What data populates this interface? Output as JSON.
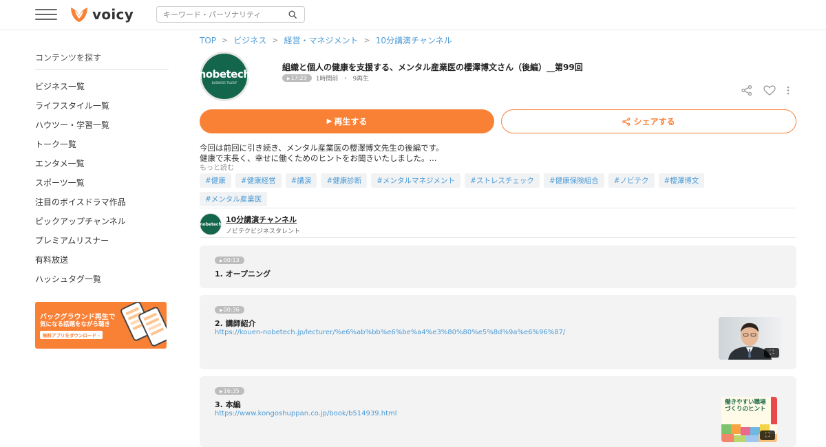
{
  "header": {
    "logo_text": "voicy",
    "search_placeholder": "キーワード・パーソナリティ"
  },
  "sidebar": {
    "title": "コンテンツを探す",
    "items": [
      "ビジネス一覧",
      "ライフスタイル一覧",
      "ハウツー・学習一覧",
      "トーク一覧",
      "エンタメ一覧",
      "スポーツ一覧",
      "注目のボイスドラマ作品",
      "ピックアップチャンネル",
      "プレミアムリスナー",
      "有料放送",
      "ハッシュタグ一覧"
    ],
    "banner": {
      "line1": "バックグラウンド再生で",
      "line2": "気になる話題をながら聴き",
      "cta": "無料アプリをダウンロード ›"
    }
  },
  "breadcrumb": [
    "TOP",
    "ビジネス",
    "経営・マネジメント",
    "10分講演チャンネル"
  ],
  "episode": {
    "logo_text": "nobetech",
    "logo_sub": "BUSINESS TALENT",
    "title": "組織と個人の健康を支援する、メンタル産業医の櫻澤博文さん（後編）__第99回",
    "duration": "17:23",
    "posted": "1時間前",
    "separator": "・",
    "plays": "9再生",
    "play_label": "再生する",
    "share_label": "シェアする",
    "description_line1": "今回は前回に引き続き、メンタル産業医の櫻澤博文先生の後編です。",
    "description_line2": "健康で末長く、幸せに働くためのヒントをお聞きいたしました。...",
    "more_label": "もっと読む",
    "tags": [
      "#健康",
      "#健康経営",
      "#講演",
      "#健康診断",
      "#メンタルマネジメント",
      "#ストレスチェック",
      "#健康保険組合",
      "#ノビテク",
      "#櫻澤博文",
      "#メンタル産業医"
    ]
  },
  "channel": {
    "icon_text": "nobetech",
    "name": "10分講演チャンネル",
    "subtitle": "ノビテクビジネスタレント"
  },
  "chapters": [
    {
      "time": "00:13",
      "title": "1. オープニング",
      "link": ""
    },
    {
      "time": "00:36",
      "title": "2. 講師紹介",
      "link": "https://kouen-nobetech.jp/lecturer/%e6%ab%bb%e6%be%a4%e3%80%80%e5%8d%9a%e6%96%87/"
    },
    {
      "time": "16:35",
      "title": "3. 本編",
      "link": "https://www.kongoshuppan.co.jp/book/b514939.html"
    }
  ],
  "book_cover_text": "働きやすい職場づくりのヒント",
  "colors": {
    "accent": "#f98136",
    "link": "#4c9bd6",
    "brand_green": "#13664c"
  }
}
